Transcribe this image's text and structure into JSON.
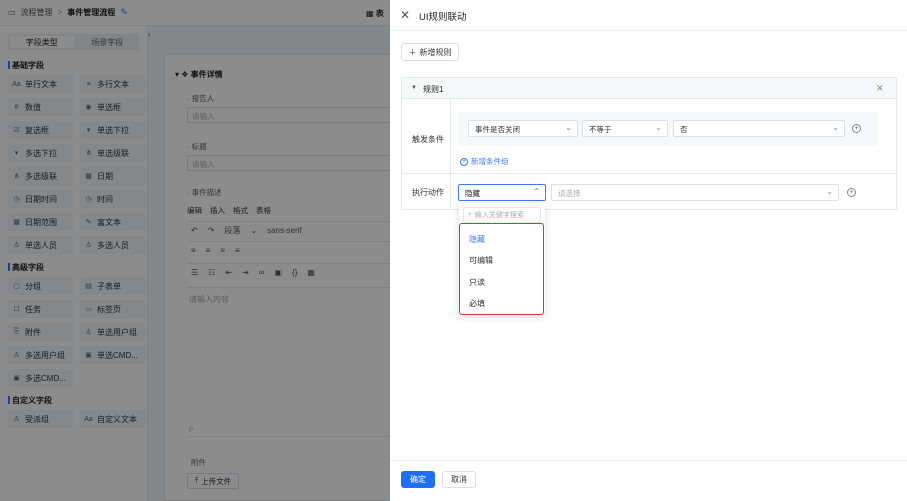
{
  "topbar": {
    "crumb_1": "流程管理",
    "crumb_sep": ">",
    "crumb_2": "事件管理流程",
    "tab_partial": "表"
  },
  "left_panel": {
    "tabs": [
      "字段类型",
      "场景字段"
    ],
    "groups": [
      {
        "title": "基础字段",
        "items": [
          "单行文本",
          "多行文本",
          "数值",
          "单选框",
          "复选框",
          "单选下拉",
          "多选下拉",
          "单选级联",
          "多选级联",
          "日期",
          "日期时间",
          "时间",
          "日期范围",
          "富文本",
          "单选人员",
          "多选人员"
        ]
      },
      {
        "title": "高级字段",
        "items": [
          "分组",
          "子表单",
          "任务",
          "标签页",
          "附件",
          "单选用户组",
          "多选用户组",
          "单选CMD...",
          "多选CMD..."
        ]
      },
      {
        "title": "自定义字段",
        "items": [
          "受派组",
          "自定义文本"
        ]
      }
    ]
  },
  "canvas": {
    "title": "事件详情",
    "field_1_label": "报告人",
    "field_1_placeholder": "请输入",
    "field_2_label": "标题",
    "field_2_placeholder": "请输入",
    "field_3_label": "事件描述",
    "menu": [
      "编辑",
      "插入",
      "格式",
      "表格"
    ],
    "toolbar_paragraph": "段落",
    "toolbar_font": "sans-serif",
    "editor_placeholder": "请输入内容",
    "editor_footer": "P",
    "attach_label": "附件",
    "upload_label": "上传文件"
  },
  "drawer": {
    "title": "UI规则联动",
    "add_rule_label": "新增规则",
    "rule": {
      "name": "规则1",
      "trigger_label": "触发条件",
      "condition": {
        "field": "事件是否关闭",
        "operator": "不等于",
        "value": "否"
      },
      "add_condition_group_label": "新增条件组",
      "action_label": "执行动作",
      "action_selected": "隐藏",
      "action_target_placeholder": "请选择"
    },
    "dropdown": {
      "search_placeholder": "输入关键字搜索",
      "options": [
        "隐藏",
        "可编辑",
        "只读",
        "必填"
      ],
      "selected_index": 0
    },
    "footer": {
      "ok_label": "确定",
      "cancel_label": "取消"
    }
  },
  "colors": {
    "primary": "#1f6ff2",
    "highlight_frame": "#e03131",
    "mask": "rgba(0,0,0,0.45)"
  }
}
